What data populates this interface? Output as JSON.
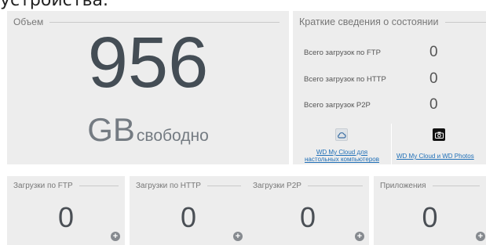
{
  "top_text": "устройства.",
  "volume": {
    "title": "Объем",
    "value": "956",
    "unit": "GB",
    "unit_word": "свободно"
  },
  "summary": {
    "title": "Краткие сведения о состоянии",
    "rows": [
      {
        "label": "Всего загрузок по FTP",
        "value": "0"
      },
      {
        "label": "Всего загрузок по HTTP",
        "value": "0"
      },
      {
        "label": "Всего загрузок P2P",
        "value": "0"
      }
    ],
    "links": [
      {
        "line1": "WD My Cloud для",
        "line2": "настольных компьютеров",
        "icon": "cloud-icon"
      },
      {
        "line1": "WD My Cloud и WD Photos",
        "icon": "camera-icon"
      }
    ]
  },
  "stats": [
    {
      "title": "Загрузки по FTP",
      "value": "0"
    },
    {
      "title": "Загрузки по HTTP",
      "value": "0"
    },
    {
      "title": "Загрузки P2P",
      "value": "0"
    },
    {
      "title": "Приложения",
      "value": "0"
    }
  ],
  "colors": {
    "panel_bg": "#ededed",
    "link": "#1f6fb7",
    "big_number": "#444d55"
  }
}
